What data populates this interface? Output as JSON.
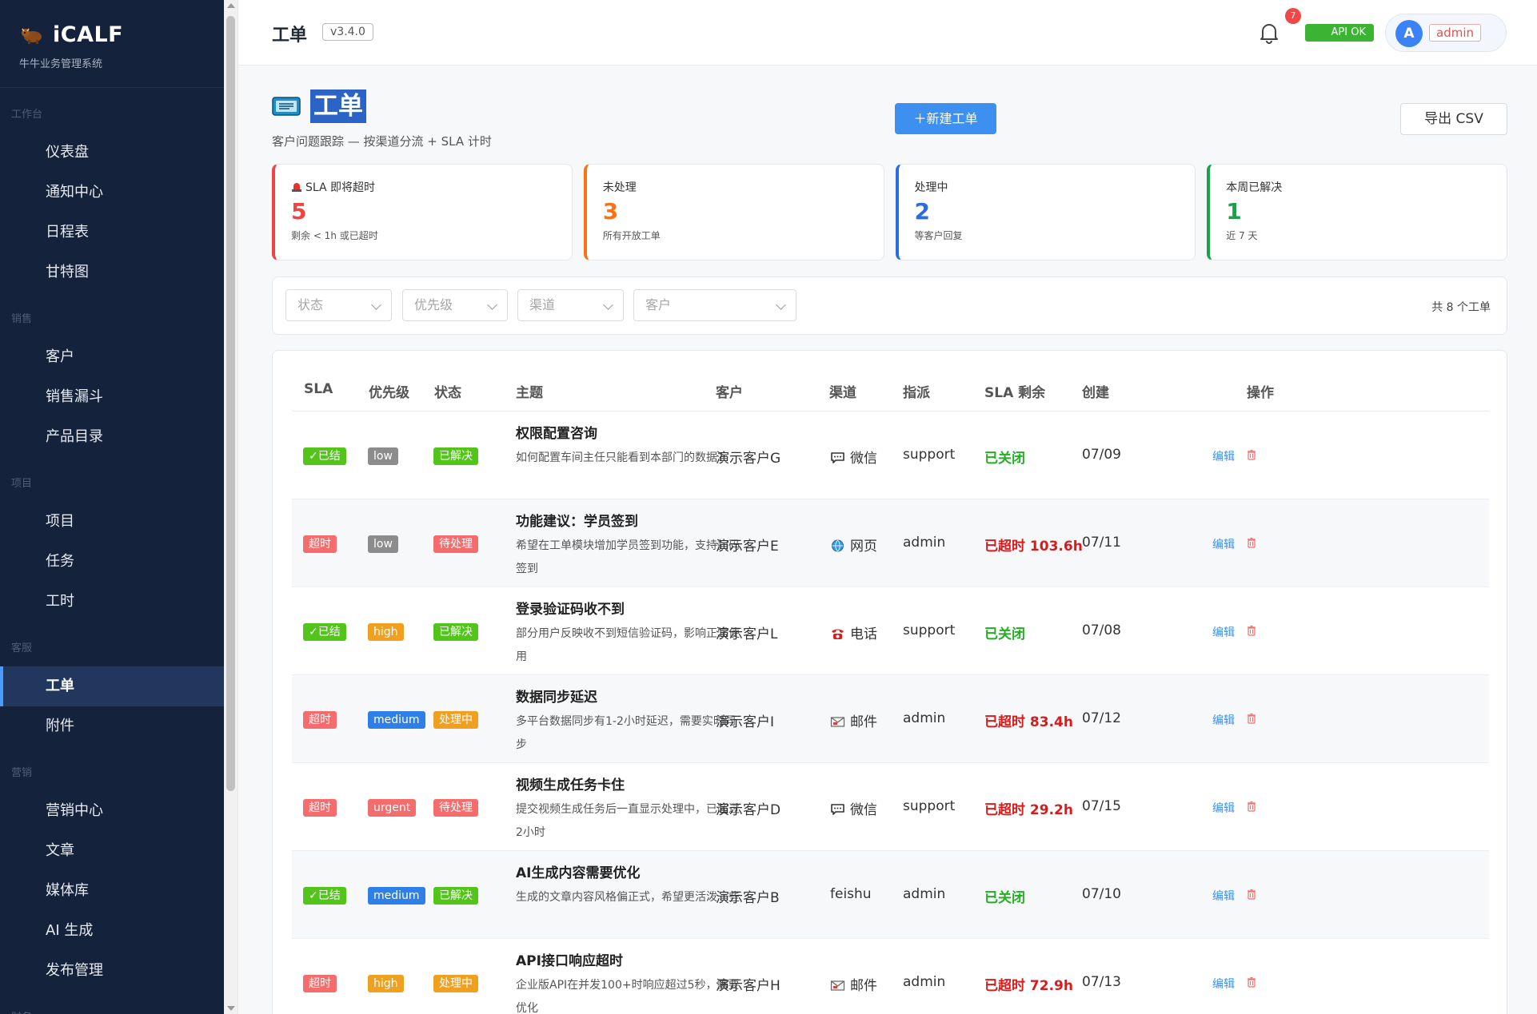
{
  "sidebar": {
    "brand_name": "iCALF",
    "brand_sub": "牛牛业务管理系统",
    "sections": [
      {
        "title": "工作台",
        "items": [
          "仪表盘",
          "通知中心",
          "日程表",
          "甘特图"
        ]
      },
      {
        "title": "销售",
        "items": [
          "客户",
          "销售漏斗",
          "产品目录"
        ]
      },
      {
        "title": "项目",
        "items": [
          "项目",
          "任务",
          "工时"
        ]
      },
      {
        "title": "客服",
        "items": [
          "工单",
          "附件"
        ]
      },
      {
        "title": "营销",
        "items": [
          "营销中心",
          "文章",
          "媒体库",
          "AI 生成",
          "发布管理"
        ]
      },
      {
        "title": "财务",
        "items": []
      }
    ]
  },
  "topbar": {
    "title": "工单",
    "version": "v3.4.0",
    "notif_count": "7",
    "api_status": "API OK",
    "avatar_letter": "A",
    "user_name": "admin"
  },
  "page": {
    "title": "工单",
    "subtitle": "客户问题跟踪 — 按渠道分流 + SLA 计时",
    "new_button": "＋新建工单",
    "export_button": "导出 CSV"
  },
  "stats": [
    {
      "label": "SLA 即将超时",
      "value": "5",
      "note": "剩余 < 1h 或已超时",
      "color": "#ef4444"
    },
    {
      "label": "未处理",
      "value": "3",
      "note": "所有开放工单",
      "color": "#f97316"
    },
    {
      "label": "处理中",
      "value": "2",
      "note": "等客户回复",
      "color": "#2b6de0"
    },
    {
      "label": "本周已解决",
      "value": "1",
      "note": "近 7 天",
      "color": "#16a34a"
    }
  ],
  "filters": {
    "status": "状态",
    "priority": "优先级",
    "channel": "渠道",
    "customer": "客户",
    "total": "共 8 个工单"
  },
  "table": {
    "headers": {
      "sla": "SLA",
      "priority": "优先级",
      "status": "状态",
      "subject": "主题",
      "customer": "客户",
      "channel": "渠道",
      "assignee": "指派",
      "sla_left": "SLA 剩余",
      "created": "创建",
      "actions": "操作"
    },
    "edit_label": "编辑",
    "rows": [
      {
        "sla": "✓已结",
        "priority": "low",
        "status": "已解决",
        "title": "权限配置咨询",
        "desc": "如何配置车间主任只能看到本部门的数据?",
        "customer": "演示客户G",
        "channel": "微信",
        "channel_icon": "wechat-icon",
        "assignee": "support",
        "sla_left": "已关闭",
        "created": "07/09"
      },
      {
        "sla": "超时",
        "priority": "low",
        "status": "待处理",
        "title": "功能建议：学员签到",
        "desc": "希望在工单模块增加学员签到功能，支持扫码签到",
        "customer": "演示客户E",
        "channel": "网页",
        "channel_icon": "globe-icon",
        "assignee": "admin",
        "sla_left": "已超时 103.6h",
        "created": "07/11"
      },
      {
        "sla": "✓已结",
        "priority": "high",
        "status": "已解决",
        "title": "登录验证码收不到",
        "desc": "部分用户反映收不到短信验证码，影响正常使用",
        "customer": "演示客户L",
        "channel": "电话",
        "channel_icon": "phone-icon",
        "assignee": "support",
        "sla_left": "已关闭",
        "created": "07/08"
      },
      {
        "sla": "超时",
        "priority": "medium",
        "status": "处理中",
        "title": "数据同步延迟",
        "desc": "多平台数据同步有1-2小时延迟，需要实时同步",
        "customer": "演示客户I",
        "channel": "邮件",
        "channel_icon": "mail-icon",
        "assignee": "admin",
        "sla_left": "已超时 83.4h",
        "created": "07/12"
      },
      {
        "sla": "超时",
        "priority": "urgent",
        "status": "待处理",
        "title": "视频生成任务卡住",
        "desc": "提交视频生成任务后一直显示处理中，已超过2小时",
        "customer": "演示客户D",
        "channel": "微信",
        "channel_icon": "wechat-icon",
        "assignee": "support",
        "sla_left": "已超时 29.2h",
        "created": "07/15"
      },
      {
        "sla": "✓已结",
        "priority": "medium",
        "status": "已解决",
        "title": "AI生成内容需要优化",
        "desc": "生成的文章内容风格偏正式，希望更活泼一些",
        "customer": "演示客户B",
        "channel": "feishu",
        "channel_icon": "",
        "assignee": "admin",
        "sla_left": "已关闭",
        "created": "07/10"
      },
      {
        "sla": "超时",
        "priority": "high",
        "status": "处理中",
        "title": "API接口响应超时",
        "desc": "企业版API在并发100+时响应超过5秒，需要优化",
        "customer": "演示客户H",
        "channel": "邮件",
        "channel_icon": "mail-icon",
        "assignee": "admin",
        "sla_left": "已超时 72.9h",
        "created": "07/13"
      }
    ]
  },
  "colors": {
    "sidebar_bg": "#15223b",
    "accent": "#3d8ff0",
    "sla_done": "#52c41a",
    "sla_over": "#f56c6c",
    "prio_low": "#8c8c8c",
    "prio_high": "#f0a020",
    "prio_medium": "#2f7fe8",
    "prio_urgent": "#f56c6c",
    "status_done": "#52c41a",
    "status_pending": "#f56c6c",
    "status_doing": "#f0a020",
    "sla_left_closed": "#22b022",
    "sla_left_over": "#d91b1b"
  },
  "active_nav": "工单"
}
